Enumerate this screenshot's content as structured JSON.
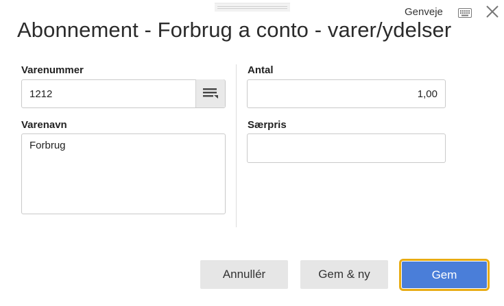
{
  "dialog": {
    "title": "Abonnement - Forbrug a conto - varer/ydelser",
    "shortcut_label": "Genveje"
  },
  "icons": {
    "keyboard": "keyboard-icon",
    "close": "close-icon",
    "lookup": "list-lookup-icon"
  },
  "form": {
    "item_number": {
      "label": "Varenummer",
      "value": "1212"
    },
    "item_name": {
      "label": "Varenavn",
      "value": "Forbrug"
    },
    "quantity": {
      "label": "Antal",
      "value": "1,00"
    },
    "special_price": {
      "label": "Særpris",
      "value": ""
    }
  },
  "buttons": {
    "cancel": "Annullér",
    "save_and_new": "Gem & ny",
    "save": "Gem"
  },
  "colors": {
    "primary": "#4a7ed9",
    "focus_outline": "#e8ab12",
    "secondary": "#e6e6e6"
  }
}
